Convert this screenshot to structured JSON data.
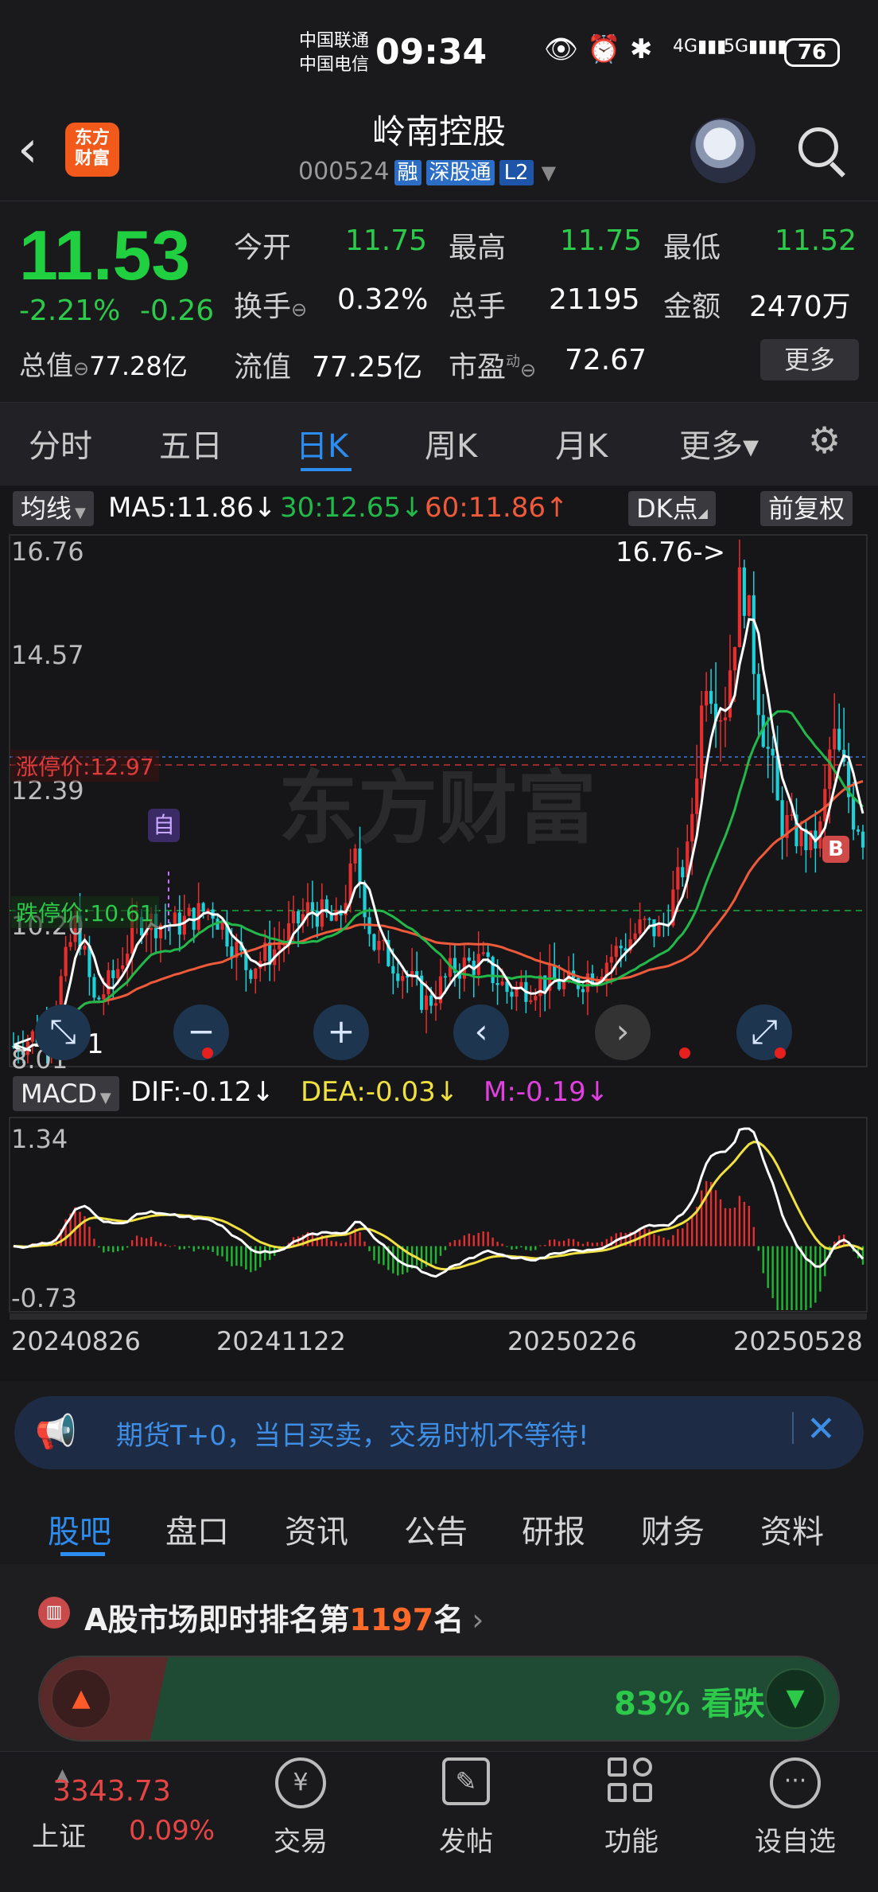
{
  "status_bar": {
    "carrier1": "中国联通",
    "carrier2": "中国电信",
    "time": "09:34",
    "battery": "76"
  },
  "header": {
    "name": "岭南控股",
    "code": "000524",
    "tags": [
      "融",
      "深股通",
      "L2"
    ],
    "logo_text": "东方\n财富"
  },
  "quote": {
    "price": "11.53",
    "change_pct": "-2.21%",
    "change_amt": "-0.26",
    "total_value_label": "总值",
    "total_value": "77.28亿",
    "open_label": "今开",
    "open": "11.75",
    "high_label": "最高",
    "high": "11.75",
    "low_label": "最低",
    "low": "11.52",
    "turnover_label": "换手",
    "turnover": "0.32%",
    "volume_label": "总手",
    "volume": "21195",
    "amount_label": "金额",
    "amount": "2470万",
    "float_label": "流值",
    "float_value": "77.25亿",
    "pe_label": "市盈",
    "pe_sup": "动",
    "pe": "72.67",
    "more_btn": "更多"
  },
  "tabs": [
    "分时",
    "五日",
    "日K",
    "周K",
    "月K",
    "更多▾"
  ],
  "chart": {
    "indicator_select": "均线",
    "ma5": "MA5:11.86↓",
    "ma30": "30:12.65↓",
    "ma60": "60:11.86↑",
    "dk_btn": "DK点",
    "fq_btn": "前复权",
    "y_labels": [
      "16.76",
      "14.57",
      "12.39",
      "10.20",
      "8.01"
    ],
    "limit_up": "涨停价:12.97",
    "limit_down": "跌停价:10.61",
    "high_marker": "16.76->",
    "low_marker": "<-8.01",
    "self_marker": "自",
    "buy_marker": "B",
    "macd_select": "MACD",
    "dif": "DIF:-0.12↓",
    "dea": "DEA:-0.03↓",
    "m": "M:-0.19↓",
    "macd_max": "1.34",
    "macd_min": "-0.73",
    "dates": [
      "20240826",
      "20241122",
      "20250226",
      "20250528"
    ],
    "watermark": "东方财富",
    "colors": {
      "up": "#e62e2e",
      "down": "#1fd0d8",
      "ma5": "#ffffff",
      "ma30": "#22b94a",
      "ma60": "#ef5a3a"
    }
  },
  "banner": {
    "text": "期货T+0，当日买卖，交易时机不等待!"
  },
  "bottom_tabs": [
    "股吧",
    "盘口",
    "资讯",
    "公告",
    "研报",
    "财务",
    "资料"
  ],
  "ranking": {
    "prefix": "A股市场即时排名第",
    "rank": "1197",
    "suffix": "名",
    "bear_pct": "83% 看跌"
  },
  "bottom_nav": {
    "index_value": "3343.73",
    "index_name": "上证",
    "index_change": "0.09%",
    "items": [
      "交易",
      "发帖",
      "功能",
      "设自选"
    ]
  }
}
